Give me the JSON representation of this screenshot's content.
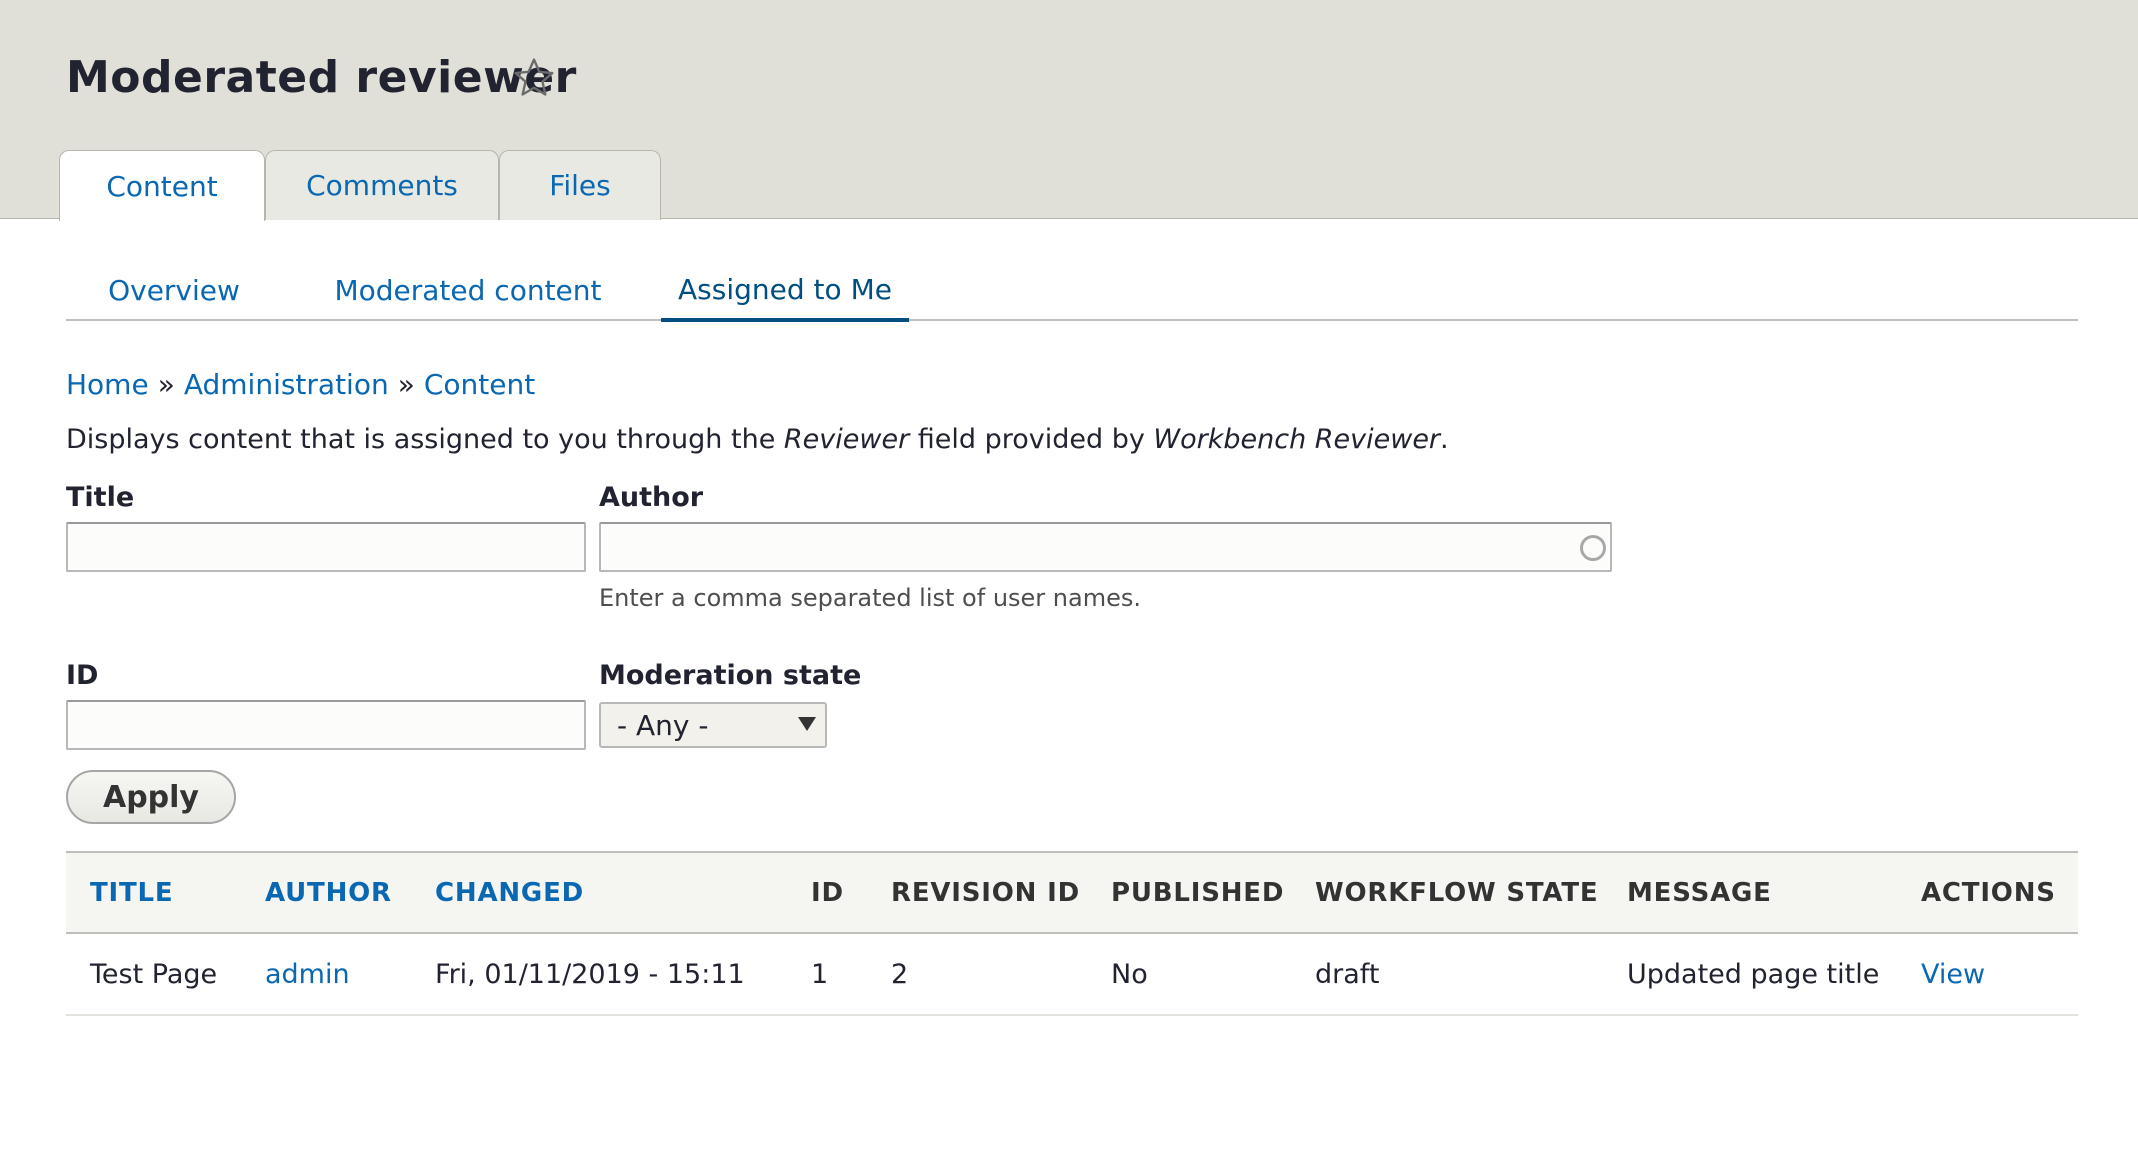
{
  "page": {
    "title": "Moderated reviewer"
  },
  "primary_tabs": [
    {
      "label": "Content",
      "active": true
    },
    {
      "label": "Comments",
      "active": false
    },
    {
      "label": "Files",
      "active": false
    }
  ],
  "secondary_tabs": [
    {
      "label": "Overview",
      "active": false
    },
    {
      "label": "Moderated content",
      "active": false
    },
    {
      "label": "Assigned to Me",
      "active": true
    }
  ],
  "breadcrumb": {
    "items": [
      "Home",
      "Administration",
      "Content"
    ],
    "separator": "»"
  },
  "description": {
    "part1": "Displays content that is assigned to you through the ",
    "em1": "Reviewer",
    "part2": " field provided by ",
    "em2": "Workbench Reviewer",
    "part3": "."
  },
  "filters": {
    "title_label": "Title",
    "title_value": "",
    "author_label": "Author",
    "author_value": "",
    "author_help": "Enter a comma separated list of user names.",
    "id_label": "ID",
    "id_value": "",
    "moderation_label": "Moderation state",
    "moderation_value": "- Any -",
    "apply_label": "Apply"
  },
  "table": {
    "headers": [
      "TITLE",
      "AUTHOR",
      "CHANGED",
      "ID",
      "REVISION ID",
      "PUBLISHED",
      "WORKFLOW STATE",
      "MESSAGE",
      "ACTIONS"
    ],
    "rows": [
      {
        "title": "Test Page",
        "author": "admin",
        "changed": "Fri, 01/11/2019 - 15:11",
        "id": "1",
        "revision_id": "2",
        "published": "No",
        "workflow_state": "draft",
        "message": "Updated page title",
        "action": "View"
      }
    ]
  },
  "colors": {
    "link": "#0a68b3",
    "header_bg": "#e0e0d8",
    "active_tab_underline": "#004f80"
  }
}
